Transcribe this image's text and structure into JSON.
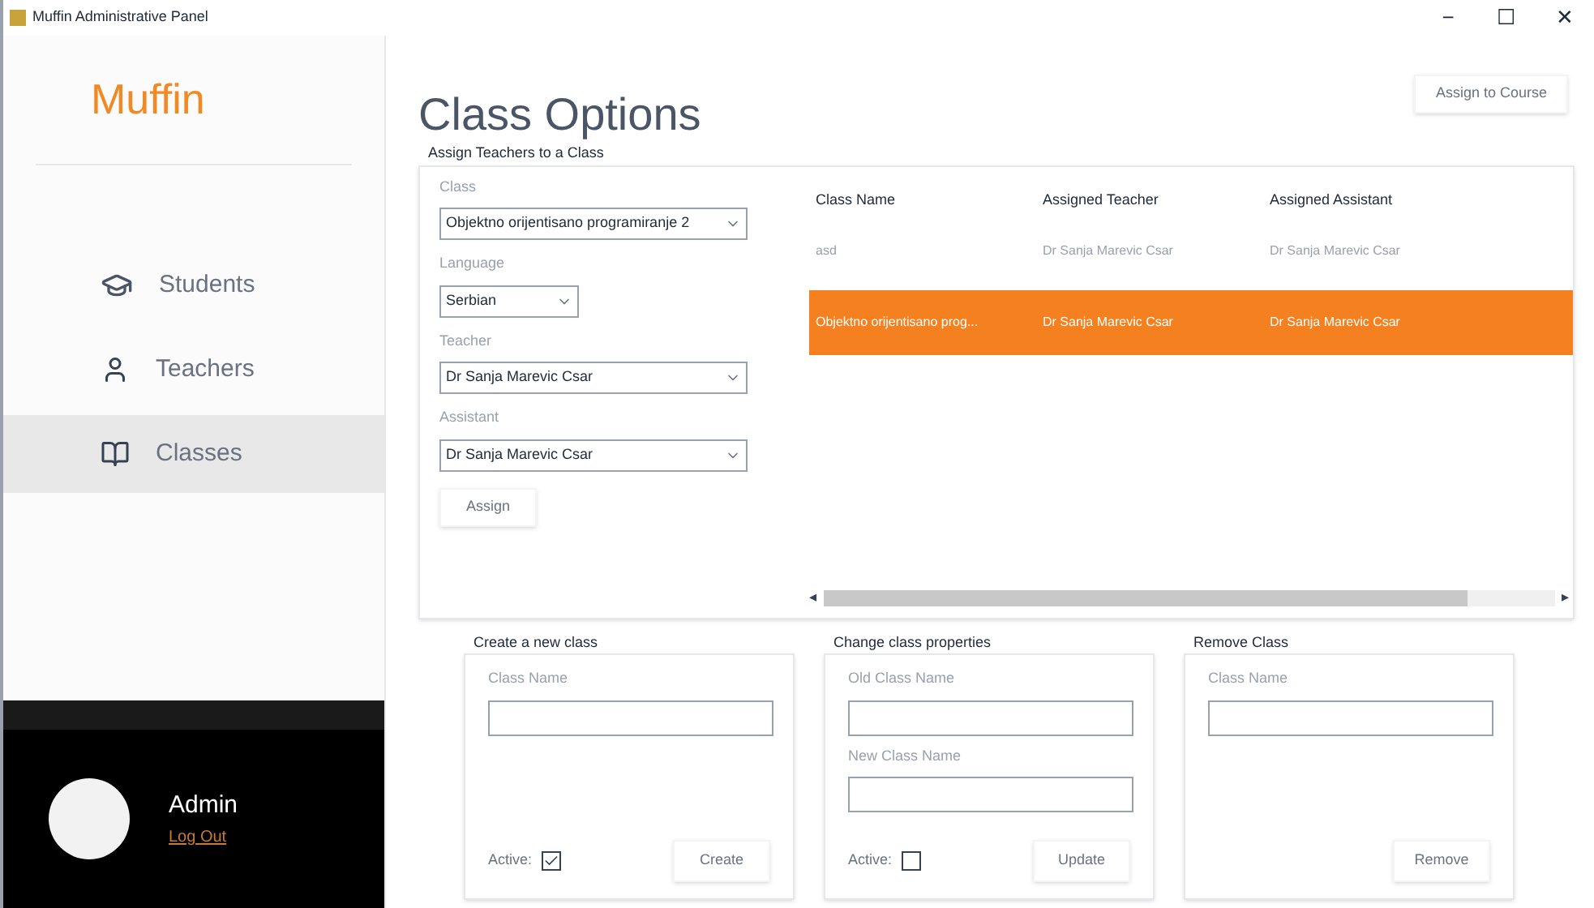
{
  "window": {
    "title": "Muffin Administrative Panel",
    "controls": [
      "−",
      "☐",
      "✕"
    ]
  },
  "sidebar": {
    "logo": "Muffin",
    "items": [
      {
        "label": "Students",
        "selected": false
      },
      {
        "label": "Teachers",
        "selected": false
      },
      {
        "label": "Classes",
        "selected": true
      }
    ],
    "user": {
      "name": "Admin",
      "link": "Log Out"
    }
  },
  "page": {
    "title": "Class Options",
    "top_button": "Assign to Course"
  },
  "assign": {
    "legend": "Assign Teachers to a Class",
    "fields": [
      {
        "label": "Class",
        "value": "Objektno orijentisano programiranje 2"
      },
      {
        "label": "Language",
        "value": "Serbian"
      },
      {
        "label": "Teacher",
        "value": "Dr Sanja Marevic Csar"
      },
      {
        "label": "Assistant",
        "value": "Dr Sanja Marevic Csar"
      }
    ],
    "button": "Assign",
    "table": {
      "columns": [
        "Class Name",
        "Assigned Teacher",
        "Assigned Assistant"
      ],
      "rows": [
        {
          "cells": [
            "asd",
            "Dr Sanja Marevic Csar",
            "Dr Sanja Marevic Csar"
          ],
          "selected": false
        },
        {
          "cells": [
            "Objektno orijentisano prog...",
            "Dr Sanja Marevic Csar",
            "Dr Sanja Marevic Csar"
          ],
          "selected": true
        }
      ],
      "scroll_left": "◂",
      "scroll_right": "▸"
    }
  },
  "groups": [
    {
      "legend": "Create a new class",
      "fields": [
        "Class Name"
      ],
      "active": {
        "label": "Active:",
        "checked": true
      },
      "button": "Create"
    },
    {
      "legend": "Change class properties",
      "fields": [
        "Old Class Name",
        "New Class Name"
      ],
      "active": {
        "label": "Active:",
        "checked": false
      },
      "button": "Update"
    },
    {
      "legend": "Remove Class",
      "fields": [
        "Class Name"
      ],
      "button": "Remove"
    }
  ]
}
